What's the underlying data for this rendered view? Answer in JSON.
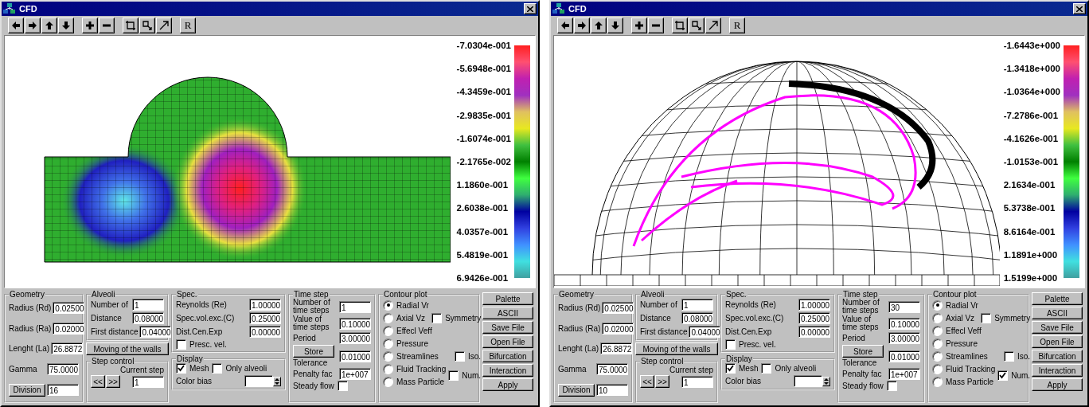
{
  "windows": [
    {
      "title": "CFD",
      "toolbar": {
        "reset_label": "R"
      },
      "plot": {
        "kind": "contour"
      },
      "colorbar": {
        "labels": [
          "-7.0304e-001",
          "-5.6948e-001",
          "-4.3459e-001",
          "-2.9835e-001",
          "-1.6074e-001",
          "-2.1765e-002",
          "1.1860e-001",
          "2.6038e-001",
          "4.0357e-001",
          "5.4819e-001",
          "6.9426e-001"
        ]
      },
      "geometry": {
        "title": "Geometry",
        "fields": [
          {
            "label": "Radius (Rd)",
            "value": "0.02500"
          },
          {
            "label": "Radius (Ra)",
            "value": "0.02000"
          },
          {
            "label": "Lenght (La)",
            "value": "26.8872"
          },
          {
            "label": "Gamma",
            "value": "75.0000"
          }
        ],
        "division_button": "Division",
        "division_value": "16"
      },
      "alveoli": {
        "title": "Alveoli",
        "fields": [
          {
            "label": "Number of",
            "value": "1"
          },
          {
            "label": "Distance",
            "value": "0.08000"
          },
          {
            "label": "First distance",
            "value": "0.04000"
          }
        ]
      },
      "walls_button": "Moving of the walls",
      "step_control": {
        "title": "Step control",
        "prev_button": "<<",
        "next_button": ">>",
        "current_label": "Current step",
        "current_value": "1"
      },
      "spec": {
        "title": "Spec.",
        "fields": [
          {
            "label": "Reynolds (Re)",
            "value": "1.00000"
          },
          {
            "label": "Spec.vol.exc.(C)",
            "value": "0.25000"
          },
          {
            "label": "Dist.Cen.Exp",
            "value": "0.00000"
          }
        ],
        "presc_vel": {
          "label": "Presc. vel.",
          "checked": false
        }
      },
      "display": {
        "title": "Display",
        "mesh": {
          "label": "Mesh",
          "checked": true
        },
        "only_alveoli": {
          "label": "Only alveoli",
          "checked": false
        },
        "color_bias_label": "Color bias"
      },
      "time_step": {
        "title": "Time step",
        "fields": [
          {
            "label": "Number of time steps",
            "value": "1"
          },
          {
            "label": "Value of time steps",
            "value": "0.10000"
          },
          {
            "label": "Period",
            "value": "3.00000"
          }
        ],
        "store_button": "Store",
        "tolerance": {
          "label": "Tolerance",
          "value": "0.01000"
        },
        "penalty": {
          "label": "Penalty fac",
          "value": "1e+007"
        },
        "steady_flow": {
          "label": "Steady flow",
          "checked": false
        }
      },
      "contour": {
        "title": "Contour plot",
        "options": [
          {
            "label": "Radial Vr",
            "selected": true
          },
          {
            "label": "Axial Vz",
            "selected": false
          },
          {
            "label": "Effecl Veff",
            "selected": false
          },
          {
            "label": "Pressure",
            "selected": false
          },
          {
            "label": "Streamlines",
            "selected": false
          },
          {
            "label": "Fluid Tracking",
            "selected": false
          },
          {
            "label": "Mass Particle",
            "selected": false
          }
        ],
        "symmetry": {
          "label": "Symmetry",
          "checked": false
        },
        "iso": {
          "label": "Iso.",
          "checked": false
        },
        "num": {
          "label": "Num.",
          "checked": false
        }
      },
      "buttons": [
        "Palette",
        "ASCII",
        "Save File",
        "Open File",
        "Bifurcation",
        "Interaction",
        "Apply"
      ]
    },
    {
      "title": "CFD",
      "toolbar": {
        "reset_label": "R"
      },
      "plot": {
        "kind": "tracking"
      },
      "colorbar": {
        "labels": [
          "-1.6443e+000",
          "-1.3418e+000",
          "-1.0364e+000",
          "-7.2786e-001",
          "-4.1626e-001",
          "-1.0153e-001",
          "2.1634e-001",
          "5.3738e-001",
          "8.6164e-001",
          "1.1891e+000",
          "1.5199e+000"
        ]
      },
      "geometry": {
        "title": "Geometry",
        "fields": [
          {
            "label": "Radius (Rd)",
            "value": "0.02500"
          },
          {
            "label": "Radius (Ra)",
            "value": "0.02000"
          },
          {
            "label": "Lenght (La)",
            "value": "26.8872"
          },
          {
            "label": "Gamma",
            "value": "75.0000"
          }
        ],
        "division_button": "Division",
        "division_value": "10"
      },
      "alveoli": {
        "title": "Alveoli",
        "fields": [
          {
            "label": "Number of",
            "value": "1"
          },
          {
            "label": "Distance",
            "value": "0.08000"
          },
          {
            "label": "First distance",
            "value": "0.04000"
          }
        ]
      },
      "walls_button": "Moving of the walls",
      "step_control": {
        "title": "Step control",
        "prev_button": "<<",
        "next_button": ">>",
        "current_label": "Current step",
        "current_value": "1"
      },
      "spec": {
        "title": "Spec.",
        "fields": [
          {
            "label": "Reynolds (Re)",
            "value": "1.00000"
          },
          {
            "label": "Spec.vol.exc.(C)",
            "value": "0.25000"
          },
          {
            "label": "Dist.Cen.Exp",
            "value": "0.00000"
          }
        ],
        "presc_vel": {
          "label": "Presc. vel.",
          "checked": false
        }
      },
      "display": {
        "title": "Display",
        "mesh": {
          "label": "Mesh",
          "checked": true
        },
        "only_alveoli": {
          "label": "Only alveoli",
          "checked": false
        },
        "color_bias_label": "Color bias"
      },
      "time_step": {
        "title": "Time step",
        "fields": [
          {
            "label": "Number of time steps",
            "value": "30"
          },
          {
            "label": "Value of time steps",
            "value": "0.10000"
          },
          {
            "label": "Period",
            "value": "3.00000"
          }
        ],
        "store_button": "Store",
        "tolerance": {
          "label": "Tolerance",
          "value": "0.01000"
        },
        "penalty": {
          "label": "Penalty fac",
          "value": "1e+007"
        },
        "steady_flow": {
          "label": "Steady flow",
          "checked": false
        }
      },
      "contour": {
        "title": "Contour plot",
        "options": [
          {
            "label": "Radial Vr",
            "selected": true
          },
          {
            "label": "Axial Vz",
            "selected": false
          },
          {
            "label": "Effecl Veff",
            "selected": false
          },
          {
            "label": "Pressure",
            "selected": false
          },
          {
            "label": "Streamlines",
            "selected": false
          },
          {
            "label": "Fluid Tracking",
            "selected": false
          },
          {
            "label": "Mass Particle",
            "selected": false
          }
        ],
        "symmetry": {
          "label": "Symmetry",
          "checked": false
        },
        "iso": {
          "label": "Iso.",
          "checked": false
        },
        "num": {
          "label": "Num.",
          "checked": true
        }
      },
      "buttons": [
        "Palette",
        "ASCII",
        "Save File",
        "Open File",
        "Bifurcation",
        "Interaction",
        "Apply"
      ]
    }
  ]
}
